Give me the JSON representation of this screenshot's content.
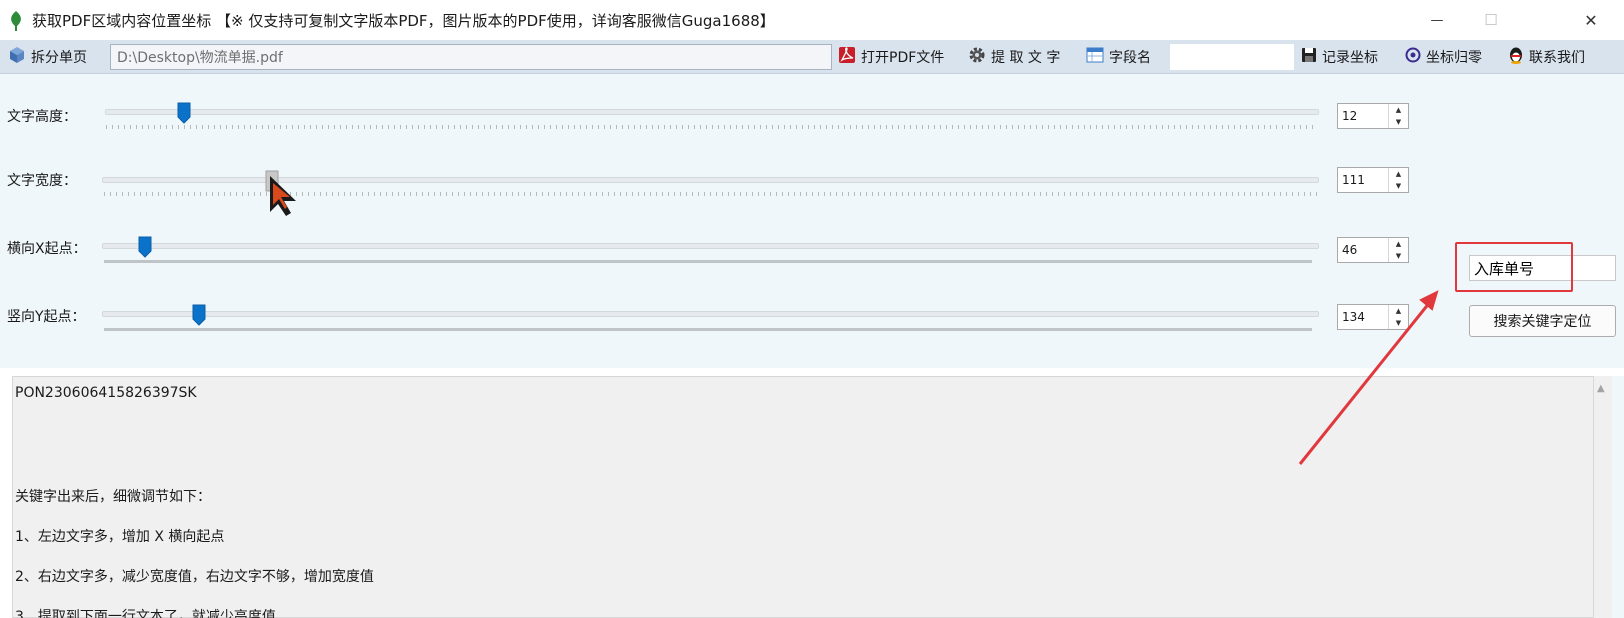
{
  "window": {
    "title": "获取PDF区域内容位置坐标 【※ 仅支持可复制文字版本PDF，图片版本的PDF使用，详询客服微信Guga1688】",
    "minimize": "—",
    "maximize": "☐",
    "close": "✕"
  },
  "toolbar": {
    "split_label": "拆分单页",
    "file_path": "D:\\Desktop\\物流单据.pdf",
    "open_pdf_label": "打开PDF文件",
    "extract_label": "提 取 文 字",
    "field_name_label": "字段名",
    "field_name_value": "",
    "record_label": "记录坐标",
    "reset_label": "坐标归零",
    "contact_label": "联系我们"
  },
  "controls": {
    "height": {
      "label": "文字高度：",
      "value": "12",
      "level": 0.06
    },
    "width": {
      "label": "文字宽度：",
      "value": "111",
      "level": 0.135
    },
    "x_start": {
      "label": "横向X起点：",
      "value": "46",
      "level": 0.03
    },
    "y_start": {
      "label": "竖向Y起点：",
      "value": "134",
      "level": 0.075
    }
  },
  "keyword": {
    "value": "入库单号",
    "search_label": "搜索关键字定位"
  },
  "output": {
    "lines": [
      "PON230606415826397SK",
      "关键字出来后，细微调节如下：",
      "1、左边文字多，增加 X 横向起点",
      "2、右边文字多，减少宽度值，右边文字不够，增加宽度值",
      "3、提取到下面一行文本了，就减少高度值"
    ]
  },
  "colors": {
    "accent": "#0a72c9",
    "annotation": "#e0383c",
    "panel_bg": "#f0f7fb",
    "toolbar_bg": "#d9e3ee"
  }
}
